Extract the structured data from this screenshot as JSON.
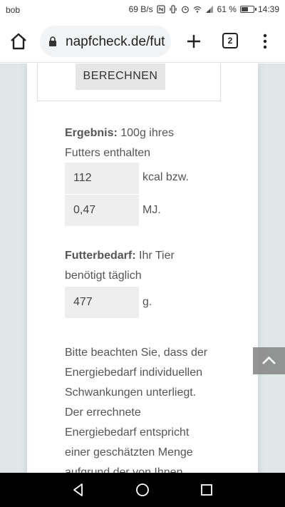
{
  "status_bar": {
    "carrier": "bob",
    "speed": "69 B/s",
    "battery_percent": "61 %",
    "battery_level": 0.61,
    "time": "14:39"
  },
  "browser": {
    "url": "napfcheck.de/fut",
    "tab_count": "2"
  },
  "calculator": {
    "calculate_label": "BERECHNEN",
    "result_heading": "Ergebnis:",
    "result_text": " 100g ihres",
    "result_text2": "Futters enthalten",
    "kcal_value": "112",
    "kcal_unit": "kcal bzw.",
    "mj_value": "0,47",
    "mj_unit": "MJ.",
    "need_heading": "Futterbedarf:",
    "need_text": " Ihr Tier",
    "need_text2": "benötigt täglich",
    "grams_value": "477",
    "grams_unit": "g."
  },
  "notice": {
    "lines": [
      "Bitte beachten Sie, dass der",
      "Energiebedarf individuellen",
      "Schwankungen unterliegt.",
      "Der errechnete",
      "Energiebedarf entspricht",
      "einer geschätzten Menge",
      "aufgrund der von Ihnen"
    ]
  },
  "icons": {
    "home": "home-icon",
    "lock": "lock-icon",
    "plus": "plus-icon",
    "menu": "more-vert-icon",
    "scroll_top": "chevron-up-icon",
    "back": "back-triangle-icon",
    "home_nav": "circle-home-icon",
    "recents": "square-recents-icon"
  }
}
